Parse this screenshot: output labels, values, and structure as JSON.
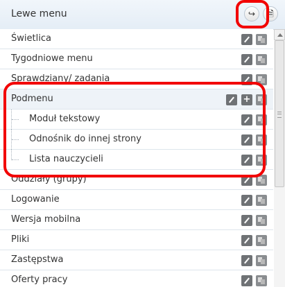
{
  "header": {
    "title": "Lewe menu",
    "redirect_icon": "↪",
    "page_icon": "🗎"
  },
  "menu": {
    "items": [
      {
        "label": "Świetlica"
      },
      {
        "label": "Tygodniowe menu"
      },
      {
        "label": "Sprawdziany/ zadania"
      },
      {
        "label": "Podmenu"
      },
      {
        "label": "Moduł tekstowy"
      },
      {
        "label": "Odnośnik do innej strony"
      },
      {
        "label": "Lista nauczycieli"
      },
      {
        "label": "Oddziały (grupy)"
      },
      {
        "label": "Logowanie"
      },
      {
        "label": "Wersja mobilna"
      },
      {
        "label": "Pliki"
      },
      {
        "label": "Zastępstwa"
      },
      {
        "label": "Oferty pracy"
      }
    ],
    "add_symbol": "+"
  },
  "colors": {
    "highlight": "#f20000",
    "submenu_header_bg": "#eef3f8",
    "header_bg": "#e4edf6"
  }
}
